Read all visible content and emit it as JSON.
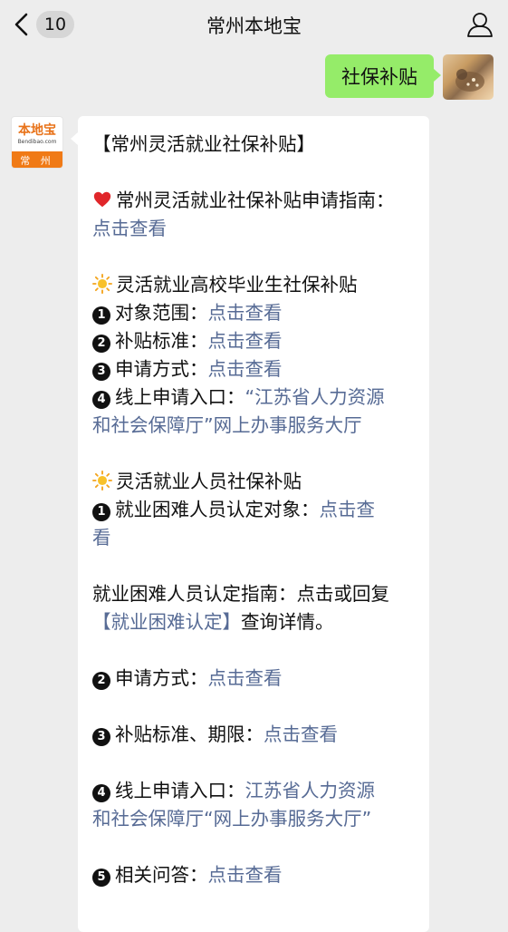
{
  "header": {
    "unread_count": "10",
    "title": "常州本地宝"
  },
  "outgoing": {
    "text": "社保补贴"
  },
  "bot_avatar": {
    "brand": "本地宝",
    "url": "Bendibao.com",
    "city": "常 州"
  },
  "reply": {
    "title": "【常州灵活就业社保补贴】",
    "guide_label": "常州灵活就业社保补贴申请指南：",
    "guide_link": "点击查看",
    "grad_heading": "灵活就业高校毕业生社保补贴",
    "grad_items": [
      {
        "num": "1",
        "label": "对象范围：",
        "link": "点击查看"
      },
      {
        "num": "2",
        "label": "补贴标准：",
        "link": "点击查看"
      },
      {
        "num": "3",
        "label": "申请方式：",
        "link": "点击查看"
      }
    ],
    "grad_online_num": "4",
    "grad_online_label": "线上申请入口：",
    "grad_online_link_1": "“江苏省人力资源",
    "grad_online_link_2": "和社会保障厅”网上办事服务大厅",
    "staff_heading": "灵活就业人员社保补贴",
    "staff_item1_num": "1",
    "staff_item1_label": "就业困难人员认定对象：",
    "staff_item1_link_1": "点击查",
    "staff_item1_link_2": "看",
    "difficulty_text": "就业困难人员认定指南：点击或回复",
    "difficulty_link": "【就业困难认定】",
    "difficulty_tail": "查询详情。",
    "staff_item2_num": "2",
    "staff_item2_label": "申请方式：",
    "staff_item2_link": "点击查看",
    "staff_item3_num": "3",
    "staff_item3_label": "补贴标准、期限：",
    "staff_item3_link": "点击查看",
    "staff_item4_num": "4",
    "staff_item4_label": "线上申请入口：",
    "staff_item4_link_1": "江苏省人力资源",
    "staff_item4_link_2": "和社会保障厅“网上办事服务大厅”",
    "staff_item5_num": "5",
    "staff_item5_label": "相关问答：",
    "staff_item5_link": "点击查看"
  },
  "colors": {
    "link": "#576b95",
    "bubble_out": "#95ec69",
    "background": "#ededed"
  },
  "icons": [
    "back-chevron-icon",
    "profile-icon",
    "heart-icon",
    "sun-icon"
  ]
}
